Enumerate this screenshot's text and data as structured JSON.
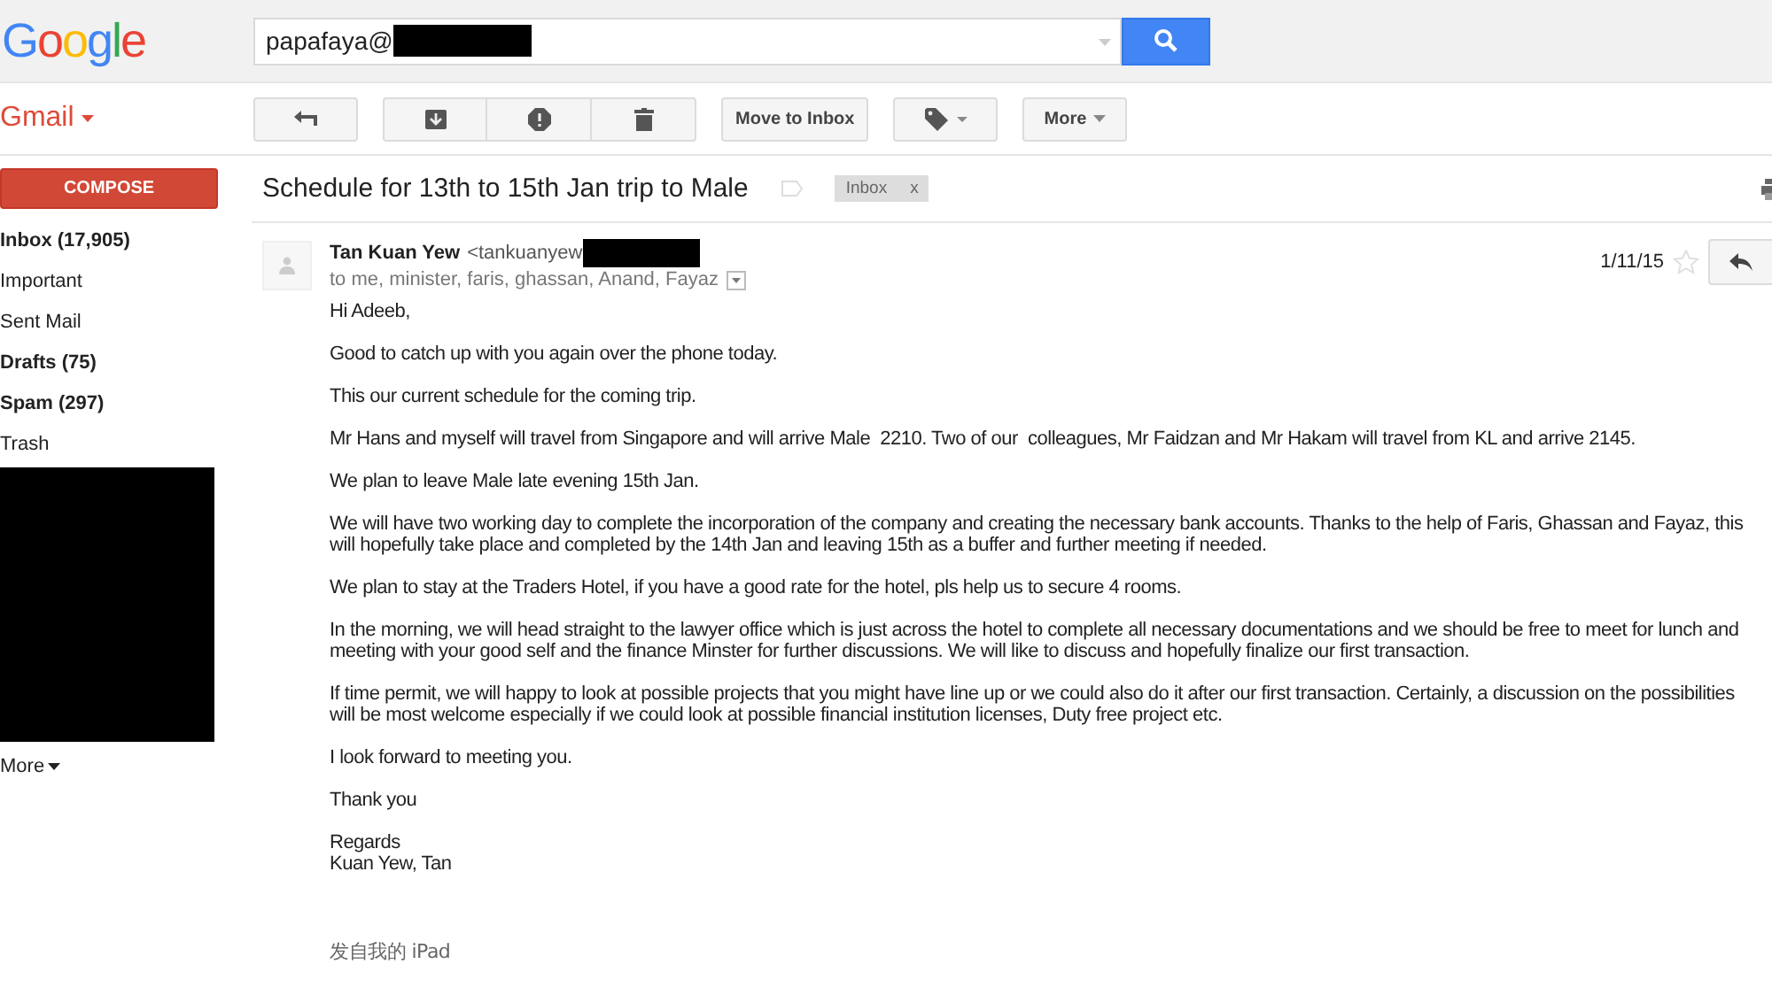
{
  "logo": "Google",
  "search": {
    "value": "papafaya@"
  },
  "app_menu": {
    "label": "Gmail"
  },
  "toolbar": [
    {
      "kind": "back"
    },
    {
      "kind": "archive"
    },
    {
      "kind": "spam"
    },
    {
      "kind": "delete"
    },
    {
      "kind": "text",
      "label": "Move to Inbox"
    },
    {
      "kind": "labels"
    },
    {
      "kind": "menu",
      "label": "More"
    }
  ],
  "compose": {
    "label": "COMPOSE"
  },
  "sidebar": {
    "items": [
      {
        "label": "Inbox (17,905)",
        "bold": true
      },
      {
        "label": "Important",
        "bold": false
      },
      {
        "label": "Sent Mail",
        "bold": false
      },
      {
        "label": "Drafts (75)",
        "bold": true
      },
      {
        "label": "Spam (297)",
        "bold": true
      },
      {
        "label": "Trash",
        "bold": false
      }
    ],
    "more": "More"
  },
  "thread": {
    "subject": "Schedule for 13th to 15th Jan trip to Male",
    "labels": [
      {
        "label": "Inbox",
        "remove": "x"
      }
    ]
  },
  "message": {
    "sender": "Tan Kuan Yew",
    "address": "<tankuanyew",
    "recipients": "to me, minister, faris, ghassan, Anand, Fayaz",
    "date": "1/11/15",
    "starred": false,
    "paragraphs": [
      [
        "Hi Adeeb,"
      ],
      [
        "Good to catch up with you again over the phone today."
      ],
      [
        "This our current schedule for the coming trip."
      ],
      [
        "Mr Hans and myself will travel from Singapore and will arrive Male  2210. Two of our  colleagues, Mr Faidzan and Mr Hakam will travel from KL and arrive 2145."
      ],
      [
        "We plan to leave Male late evening 15th Jan."
      ],
      [
        "We will have two working day to complete the incorporation of the company and creating the necessary bank accounts. Thanks to the help of Faris, Ghassan and Fayaz, this",
        "will hopefully take place and completed by the 14th Jan and leaving 15th as a buffer and further meeting if needed."
      ],
      [
        "We plan to stay at the Traders Hotel, if you have a good rate for the hotel, pls help us to secure 4 rooms."
      ],
      [
        "In the morning, we will head straight to the lawyer office which is just across the hotel to complete all necessary documentations and we should be free to meet for lunch and",
        "meeting with your good self and the finance Minster for further discussions. We will like to discuss and hopefully finalize our first transaction."
      ],
      [
        "If time permit, we will happy to look at possible projects that you might have line up or we could also do it after our first transaction. Certainly, a discussion on the possibilities",
        "will be most welcome especially if we could look at possible financial institution licenses, Duty free project etc."
      ],
      [
        "I look forward to meeting you."
      ],
      [
        "Thank you"
      ],
      [
        "Regards",
        "Kuan Yew, Tan"
      ]
    ],
    "signature": "发自我的 iPad"
  }
}
